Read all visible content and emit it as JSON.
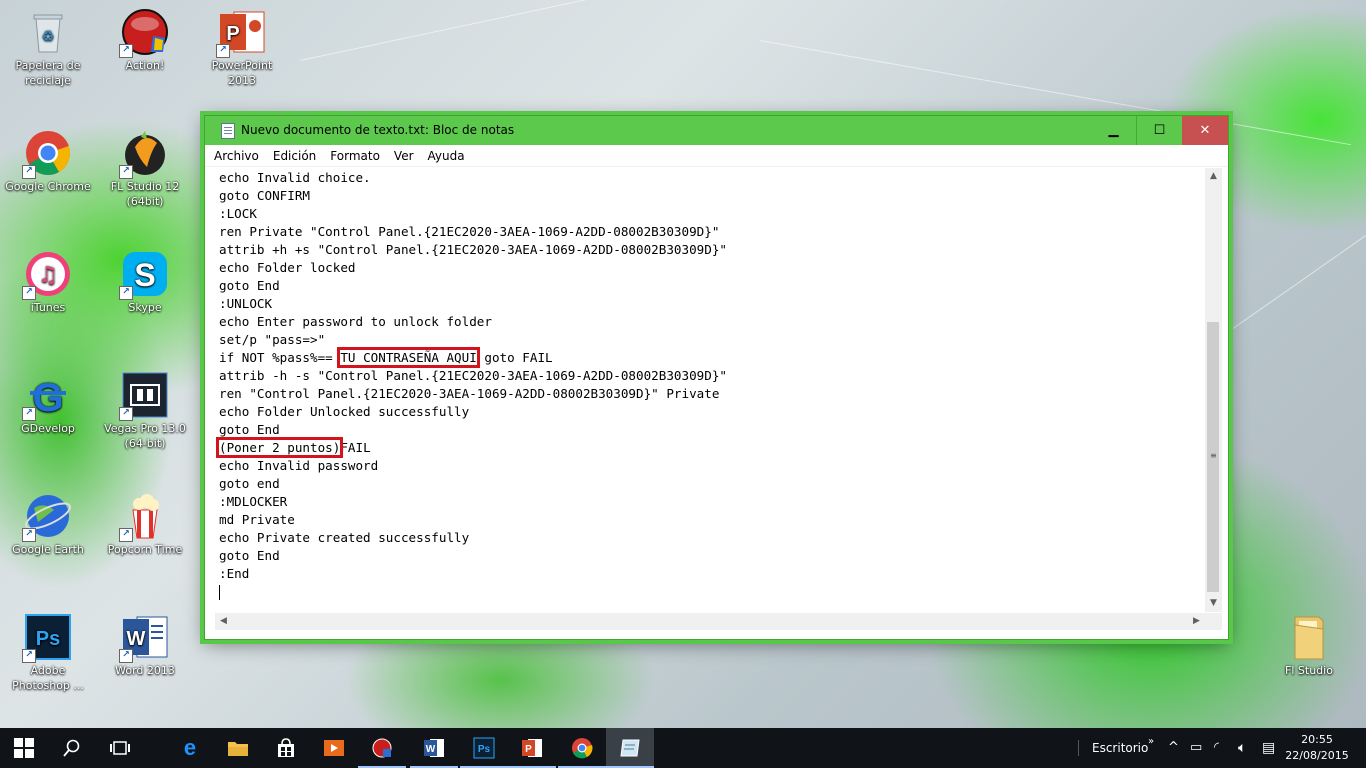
{
  "desktop": {
    "icons": [
      {
        "label": "Papelera de reciclaje",
        "icon": "recycle-bin-icon",
        "color": "#dfe6ea"
      },
      {
        "label": "Action!",
        "icon": "action-icon",
        "color": "#c81e1e"
      },
      {
        "label": "PowerPoint 2013",
        "icon": "powerpoint-icon",
        "color": "#d24726"
      },
      {
        "label": "Google Chrome",
        "icon": "chrome-icon",
        "color": "#db4437"
      },
      {
        "label": "FL Studio 12 (64bit)",
        "icon": "fl-studio-icon",
        "color": "#f29b1d"
      },
      {
        "label": "iTunes",
        "icon": "itunes-icon",
        "color": "#f0407a"
      },
      {
        "label": "Skype",
        "icon": "skype-icon",
        "color": "#00aff0"
      },
      {
        "label": "GDevelop",
        "icon": "gdevelop-icon",
        "color": "#1e6fd9"
      },
      {
        "label": "Vegas Pro 13.0 (64-bit)",
        "icon": "vegas-icon",
        "color": "#1c2430"
      },
      {
        "label": "Google Earth",
        "icon": "google-earth-icon",
        "color": "#2a6ad8"
      },
      {
        "label": "Popcorn Time",
        "icon": "popcorn-time-icon",
        "color": "#e0322c"
      },
      {
        "label": "Adobe Photoshop ...",
        "icon": "photoshop-icon",
        "color": "#0b1f35"
      },
      {
        "label": "Word 2013",
        "icon": "word-icon",
        "color": "#2b579a"
      },
      {
        "label": "Fl Studio",
        "icon": "folder-icon",
        "color": "#e9c66a"
      }
    ]
  },
  "notepad": {
    "title": "Nuevo documento de texto.txt: Bloc de notas",
    "menu": [
      "Archivo",
      "Edición",
      "Formato",
      "Ver",
      "Ayuda"
    ],
    "lines": [
      "echo Invalid choice.",
      "goto CONFIRM",
      ":LOCK",
      "ren Private \"Control Panel.{21EC2020-3AEA-1069-A2DD-08002B30309D}\"",
      "attrib +h +s \"Control Panel.{21EC2020-3AEA-1069-A2DD-08002B30309D}\"",
      "echo Folder locked",
      "goto End",
      ":UNLOCK",
      "echo Enter password to unlock folder",
      "set/p \"pass=>\""
    ],
    "line_if_prefix": "if NOT %pass%== ",
    "highlight_password": "TU CONTRASEÑA AQUI",
    "line_if_suffix": " goto FAIL",
    "lines2": [
      "attrib -h -s \"Control Panel.{21EC2020-3AEA-1069-A2DD-08002B30309D}\"",
      "ren \"Control Panel.{21EC2020-3AEA-1069-A2DD-08002B30309D}\" Private",
      "echo Folder Unlocked successfully",
      "goto End"
    ],
    "highlight_colon": "(Poner 2 puntos)",
    "line_fail_suffix": "FAIL",
    "lines3": [
      "echo Invalid password",
      "goto end",
      ":MDLOCKER",
      "md Private",
      "echo Private created successfully",
      "goto End",
      ":End"
    ],
    "highlight_color": "#d4141c"
  },
  "taskbar": {
    "apps": [
      "start-icon",
      "search-icon",
      "task-view-icon",
      "edge-icon",
      "file-explorer-icon",
      "store-icon",
      "media-player-icon",
      "action-recorder-icon",
      "word-icon",
      "photoshop-icon",
      "powerpoint-icon",
      "chrome-icon",
      "notepad-icon"
    ],
    "desktop_label": "Escritorio",
    "time": "20:55",
    "date": "22/08/2015"
  }
}
